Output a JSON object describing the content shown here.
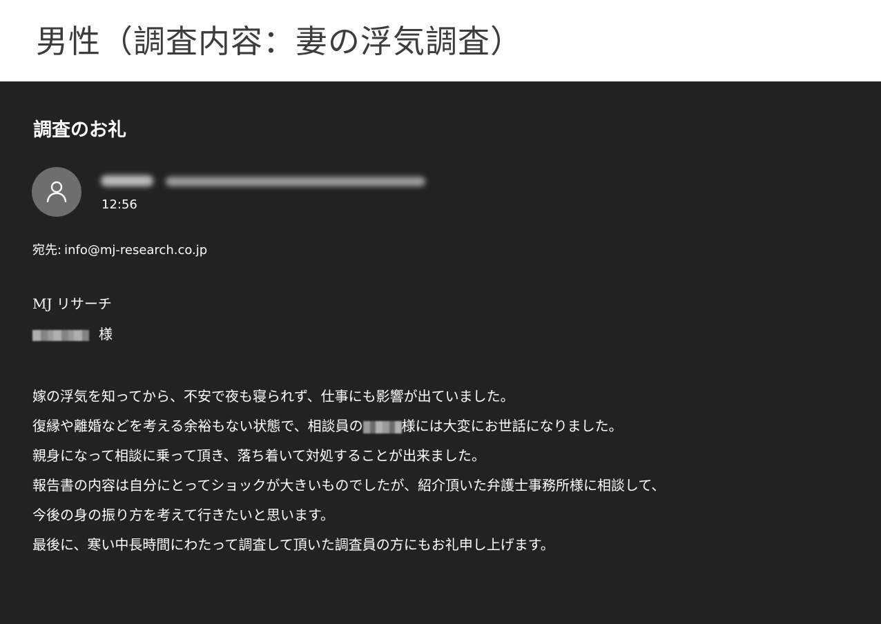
{
  "banner": {
    "title": "男性（調査内容：妻の浮気調査）"
  },
  "email": {
    "subject": "調査のお礼",
    "avatar_icon": "person-icon",
    "sender": {
      "name": "",
      "email": ""
    },
    "time": "12:56",
    "recipient_label": "宛先:",
    "recipient": "info@mj-research.co.jp",
    "addressee_company": "MJ リサーチ",
    "addressee_suffix": "様",
    "body": {
      "line1": "嫁の浮気を知ってから、不安で夜も寝られず、仕事にも影響が出ていました。",
      "line2_before": "復縁や離婚などを考える余裕もない状態で、相談員の",
      "line2_after": "様には大変にお世話になりました。",
      "line3": "親身になって相談に乗って頂き、落ち着いて対処することが出来ました。",
      "line4": "報告書の内容は自分にとってショックが大きいものでしたが、紹介頂いた弁護士事務所様に相談して、",
      "line5": "今後の身の振り方を考えて行きたいと思います。",
      "line6": "最後に、寒い中長時間にわたって調査して頂いた調査員の方にもお礼申し上げます。"
    }
  },
  "colors": {
    "panel_bg": "#222222",
    "avatar_bg": "#6e6e6e",
    "title_text": "#3c3c3c"
  }
}
